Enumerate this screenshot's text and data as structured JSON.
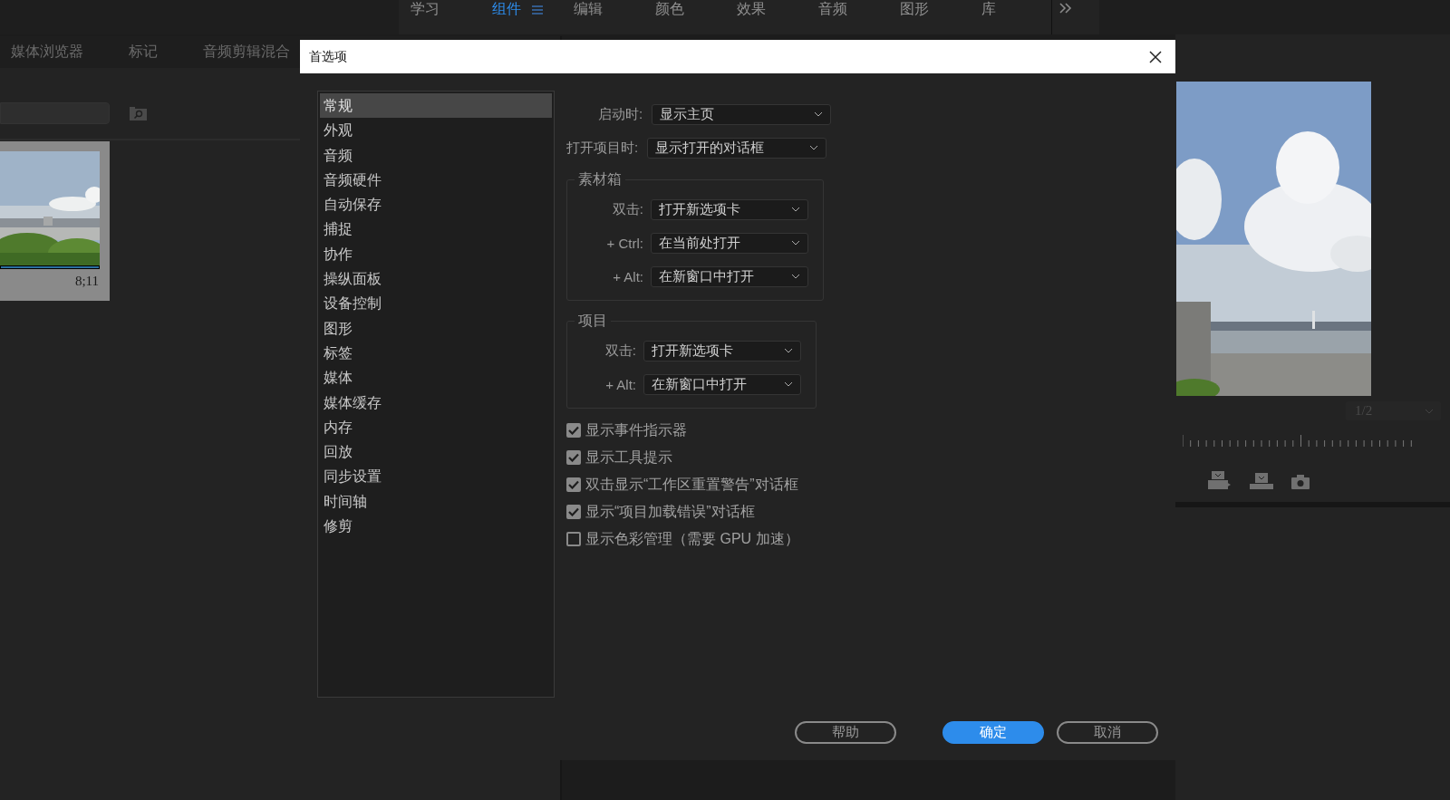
{
  "workspace_tabs": [
    {
      "label": "学习",
      "selected": false
    },
    {
      "label": "组件",
      "selected": true
    },
    {
      "label": "编辑",
      "selected": false
    },
    {
      "label": "颜色",
      "selected": false
    },
    {
      "label": "效果",
      "selected": false
    },
    {
      "label": "音频",
      "selected": false
    },
    {
      "label": "图形",
      "selected": false
    },
    {
      "label": "库",
      "selected": false
    }
  ],
  "panel_tabs": [
    "媒体浏览器",
    "标记",
    "音频剪辑混合"
  ],
  "clip": {
    "duration": "8;11"
  },
  "monitor": {
    "resolution": "1/2"
  },
  "dialog": {
    "title": "首选项",
    "categories": [
      {
        "label": "常规",
        "selected": true
      },
      {
        "label": "外观",
        "selected": false
      },
      {
        "label": "音频",
        "selected": false
      },
      {
        "label": "音频硬件",
        "selected": false
      },
      {
        "label": "自动保存",
        "selected": false
      },
      {
        "label": "捕捉",
        "selected": false
      },
      {
        "label": "协作",
        "selected": false
      },
      {
        "label": "操纵面板",
        "selected": false
      },
      {
        "label": "设备控制",
        "selected": false
      },
      {
        "label": "图形",
        "selected": false
      },
      {
        "label": "标签",
        "selected": false
      },
      {
        "label": "媒体",
        "selected": false
      },
      {
        "label": "媒体缓存",
        "selected": false
      },
      {
        "label": "内存",
        "selected": false
      },
      {
        "label": "回放",
        "selected": false
      },
      {
        "label": "同步设置",
        "selected": false
      },
      {
        "label": "时间轴",
        "selected": false
      },
      {
        "label": "修剪",
        "selected": false
      }
    ],
    "settings": [
      {
        "label": "启动时:",
        "value": "显示主页"
      },
      {
        "label": "打开项目时:",
        "value": "显示打开的对话框"
      }
    ],
    "groups": [
      {
        "title": "素材箱",
        "rows": [
          {
            "label": "双击:",
            "value": "打开新选项卡"
          },
          {
            "label": "+ Ctrl:",
            "value": "在当前处打开"
          },
          {
            "label": "+ Alt:",
            "value": "在新窗口中打开"
          }
        ]
      },
      {
        "title": "项目",
        "rows": [
          {
            "label": "双击:",
            "value": "打开新选项卡"
          },
          {
            "label": "+ Alt:",
            "value": "在新窗口中打开"
          }
        ]
      }
    ],
    "checkboxes": [
      {
        "label": "显示事件指示器",
        "checked": true
      },
      {
        "label": "显示工具提示",
        "checked": true
      },
      {
        "label": "双击显示“工作区重置警告”对话框",
        "checked": true
      },
      {
        "label": "显示“项目加载错误”对话框",
        "checked": true
      },
      {
        "label": "显示色彩管理（需要 GPU 加速）",
        "checked": false
      }
    ],
    "buttons": [
      {
        "label": "帮助",
        "kind": "secondary"
      },
      {
        "label": "确定",
        "kind": "primary"
      },
      {
        "label": "取消",
        "kind": "secondary"
      }
    ]
  }
}
